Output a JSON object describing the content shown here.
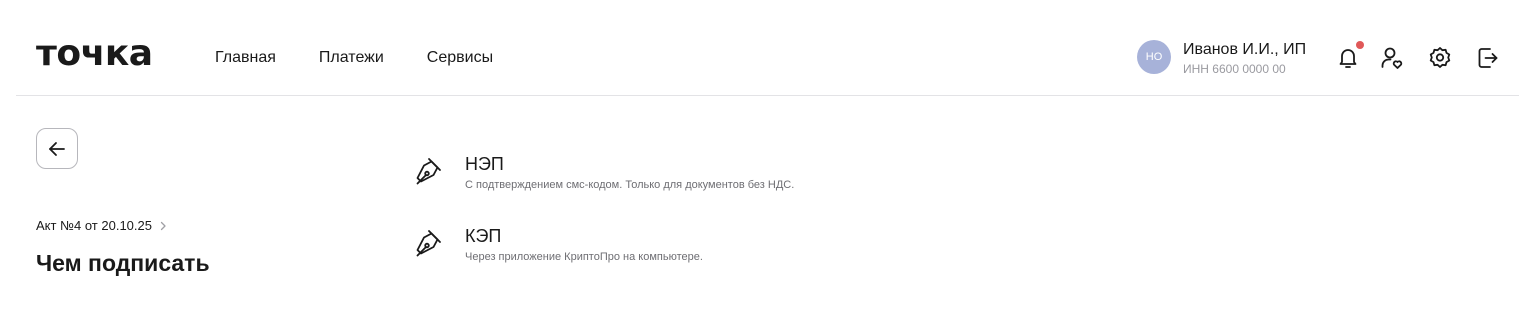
{
  "header": {
    "logo": "точка",
    "nav": [
      {
        "label": "Главная"
      },
      {
        "label": "Платежи"
      },
      {
        "label": "Сервисы"
      }
    ],
    "user": {
      "initials": "НО",
      "name": "Иванов И.И., ИП",
      "inn": "ИНН 6600 0000 00"
    },
    "icons": [
      "bell-icon",
      "user-heart-icon",
      "gear-icon",
      "logout-icon"
    ],
    "colors": {
      "avatar": "#a7b2d9",
      "notification_dot": "#e05858"
    }
  },
  "sidebar": {
    "breadcrumb": "Акт №4 от 20.10.25",
    "title": "Чем подписать"
  },
  "options": [
    {
      "title": "НЭП",
      "description": "С подтверждением смс-кодом. Только для документов без НДС."
    },
    {
      "title": "КЭП",
      "description": "Через приложение КриптоПро на компьютере."
    }
  ]
}
